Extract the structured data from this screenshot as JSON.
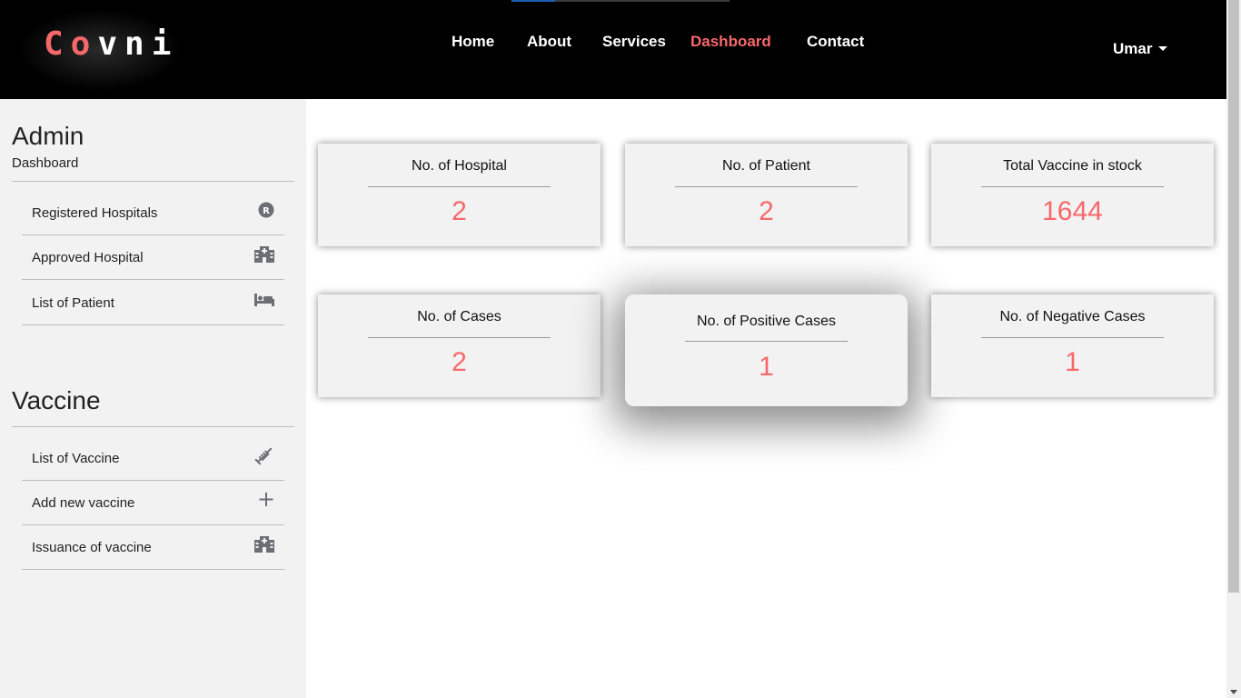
{
  "header": {
    "logo": {
      "part1": "Co",
      "part2": "v",
      "part3": "ni"
    },
    "nav": [
      {
        "label": "Home"
      },
      {
        "label": "About"
      },
      {
        "label": "Services"
      },
      {
        "label": "Dashboard"
      },
      {
        "label": "Contact"
      }
    ],
    "active_nav": "Dashboard",
    "user": "Umar"
  },
  "sidebar": {
    "admin": {
      "title": "Admin",
      "subtitle": "Dashboard",
      "items": [
        {
          "label": "Registered Hospitals",
          "icon": "registered-icon"
        },
        {
          "label": "Approved Hospital",
          "icon": "hospital-icon"
        },
        {
          "label": "List of Patient",
          "icon": "bed-icon"
        }
      ]
    },
    "vaccine": {
      "title": "Vaccine",
      "items": [
        {
          "label": "List of Vaccine",
          "icon": "syringe-icon"
        },
        {
          "label": "Add new vaccine",
          "icon": "plus-icon"
        },
        {
          "label": "Issuance of vaccine",
          "icon": "hospital-icon"
        }
      ]
    }
  },
  "cards": [
    {
      "title": "No. of Hospital",
      "value": "2"
    },
    {
      "title": "No. of Patient",
      "value": "2"
    },
    {
      "title": "Total Vaccine in stock",
      "value": "1644"
    },
    {
      "title": "No. of Cases",
      "value": "2"
    },
    {
      "title": "No. of Positive Cases",
      "value": "1"
    },
    {
      "title": "No. of Negative Cases",
      "value": "1"
    }
  ],
  "colors": {
    "accent": "#f7686b",
    "header_bg": "#000000",
    "sidebar_bg": "#f2f2f2",
    "card_bg": "#f2f2f2",
    "icon": "#6b6f75"
  }
}
